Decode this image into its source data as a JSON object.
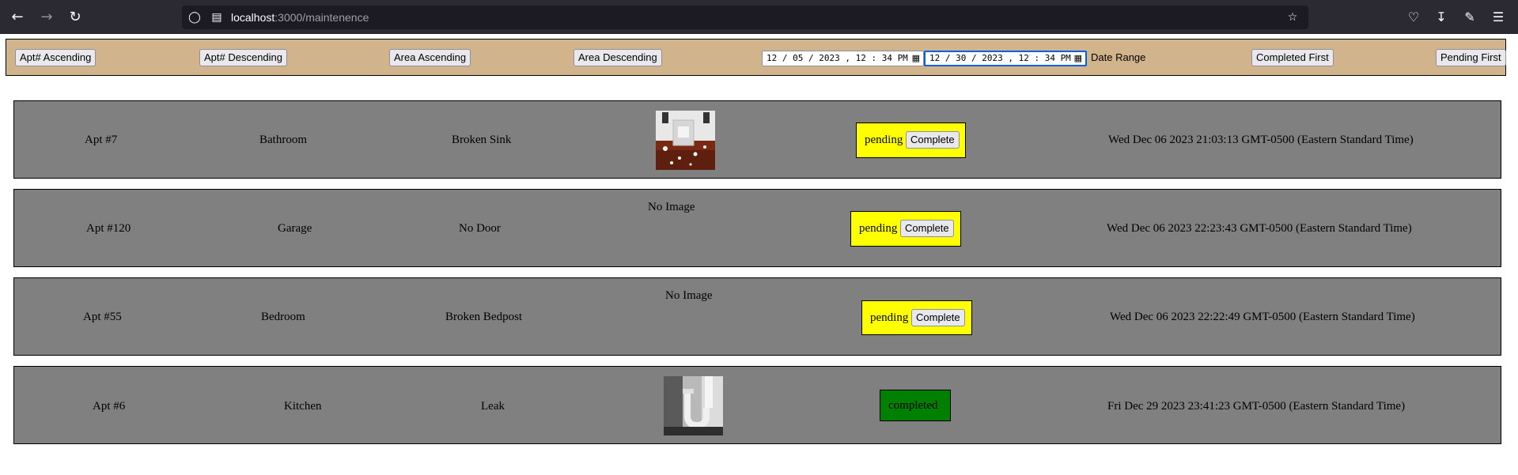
{
  "browser": {
    "url_host": "localhost",
    "url_path": ":3000/maintenence",
    "icons": {
      "back": "back-arrow-icon",
      "forward": "forward-arrow-icon",
      "reload": "reload-icon",
      "shield": "shield-icon",
      "page": "page-info-icon",
      "star": "bookmark-star-icon",
      "pocket": "pocket-icon",
      "download": "download-icon",
      "extensions": "extensions-icon",
      "menu": "hamburger-menu-icon"
    }
  },
  "toolbar": {
    "apt_asc": "Apt# Ascending",
    "apt_desc": "Apt# Descending",
    "area_asc": "Area Ascending",
    "area_desc": "Area Descending",
    "start_date": "12 / 05 / 2023 ,  12 : 34  PM",
    "end_date": "12 / 30 / 2023 ,  12 : 34  PM",
    "date_range": "Date Range",
    "completed_first": "Completed First",
    "pending_first": "Pending First"
  },
  "requests": [
    {
      "apt": "Apt #7",
      "area": "Bathroom",
      "issue": "Broken Sink",
      "image": "broken-sink-photo",
      "status": "pending",
      "action": "Complete",
      "date": "Wed Dec 06 2023 21:03:13 GMT-0500 (Eastern Standard Time)"
    },
    {
      "apt": "Apt #120",
      "area": "Garage",
      "issue": "No Door",
      "image_text": "No Image",
      "status": "pending",
      "action": "Complete",
      "date": "Wed Dec 06 2023 22:23:43 GMT-0500 (Eastern Standard Time)"
    },
    {
      "apt": "Apt #55",
      "area": "Bedroom",
      "issue": "Broken Bedpost",
      "image_text": "No Image",
      "status": "pending",
      "action": "Complete",
      "date": "Wed Dec 06 2023 22:22:49 GMT-0500 (Eastern Standard Time)"
    },
    {
      "apt": "Apt #6",
      "area": "Kitchen",
      "issue": "Leak",
      "image": "leaking-pipe-photo",
      "status": "completed",
      "date": "Fri Dec 29 2023 23:41:23 GMT-0500 (Eastern Standard Time)"
    }
  ],
  "colors": {
    "toolbar_bg": "#d2b48c",
    "row_bg": "#808080",
    "pending": "#ffff00",
    "completed": "#008000"
  }
}
